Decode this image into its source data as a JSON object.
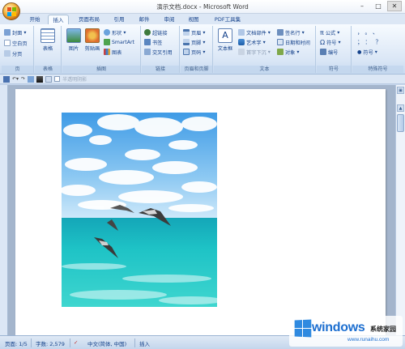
{
  "window": {
    "title": "演示文档.docx - Microsoft Word"
  },
  "tabs": [
    {
      "label": "开始"
    },
    {
      "label": "插入"
    },
    {
      "label": "页面布局"
    },
    {
      "label": "引用"
    },
    {
      "label": "邮件"
    },
    {
      "label": "审阅"
    },
    {
      "label": "视图"
    },
    {
      "label": "PDF工具集"
    }
  ],
  "ribbon": {
    "pages": {
      "label": "页",
      "cover": "封面",
      "blank": "空白页",
      "break": "分页"
    },
    "tables": {
      "label": "表格",
      "table": "表格"
    },
    "illustrations": {
      "label": "插图",
      "picture": "图片",
      "clipart": "剪贴画",
      "shapes": "形状",
      "smartart": "SmartArt",
      "chart": "图表"
    },
    "links": {
      "label": "链接",
      "hyperlink": "超链接",
      "bookmark": "书签",
      "crossref": "交叉引用"
    },
    "headerfooter": {
      "label": "页眉和页脚",
      "header": "页眉",
      "footer": "页脚",
      "pagenum": "页码"
    },
    "text": {
      "label": "文本",
      "textbox": "文本框",
      "quickparts": "文档部件",
      "wordart": "艺术字",
      "dropcap": "首字下沉",
      "signature": "签名行",
      "datetime": "日期和时间",
      "object": "对象"
    },
    "symbols": {
      "label": "符号",
      "equation": "公式",
      "symbol": "符号",
      "number": "编号"
    },
    "special": {
      "label": "特殊符号",
      "symbol": "符号"
    }
  },
  "toolbar2": {
    "checkbox_label": "半透明阴影"
  },
  "statusbar": {
    "page": "页面: 1/5",
    "words": "字数: 2,579",
    "language": "中文(简体, 中国)",
    "mode": "插入"
  },
  "watermark": {
    "title": "windows",
    "subtitle": "系统家园",
    "url": "www.runaihu.com"
  },
  "colors": {
    "accent": "#15428b",
    "ribbon_bg": "#dbe7f6",
    "page_bg": "#a4b5cc"
  }
}
